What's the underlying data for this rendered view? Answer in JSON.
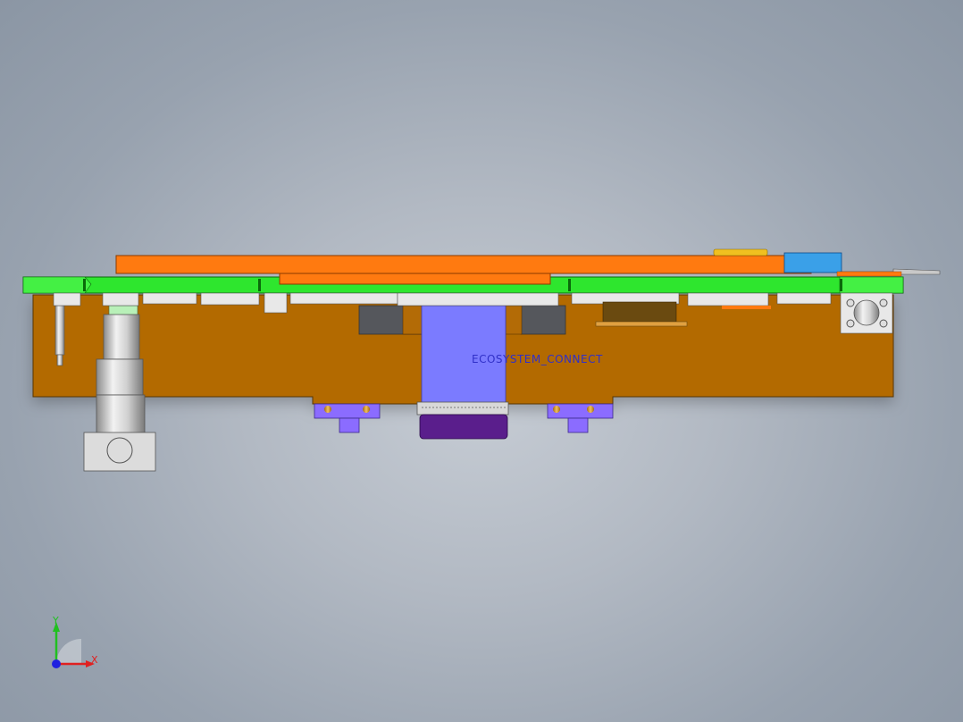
{
  "viewport": {
    "background_top": "#8b96a4",
    "background_center": "#c6ccd4"
  },
  "model": {
    "annotation_text": "ECOSYSTEM_CONNECT",
    "colors": {
      "base_plate": "#b36b06",
      "pcb_green": "#2ee62e",
      "orange_cover": "#ff7a10",
      "flex_cable": "#7b7bff",
      "connector_purple": "#5a1e8c",
      "blue_block": "#3aa0e8",
      "yellow_part": "#f0c020",
      "metal_gray": "#b8b8b8"
    }
  },
  "triad": {
    "x_label": "X",
    "y_label": "Y",
    "x_color": "#e02020",
    "y_color": "#20c020",
    "z_color": "#2020e0"
  }
}
